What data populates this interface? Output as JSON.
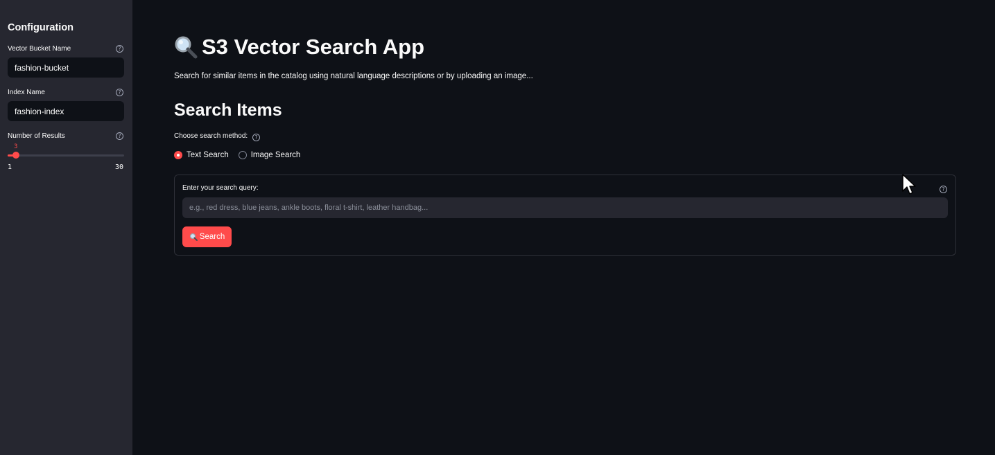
{
  "sidebar": {
    "title": "Configuration",
    "bucket_label": "Vector Bucket Name",
    "bucket_value": "fashion-bucket",
    "index_label": "Index Name",
    "index_value": "fashion-index",
    "results_label": "Number of Results",
    "results_value": "3",
    "results_min": "1",
    "results_max": "30",
    "help_glyph": "?"
  },
  "main": {
    "title": "S3 Vector Search App",
    "subtitle": "Search for similar items in the catalog using natural language descriptions or by uploading an image...",
    "section_title": "Search Items",
    "method_label": "Choose search method:",
    "methods": [
      "Text Search",
      "Image Search"
    ],
    "selected_method": "Text Search",
    "query_label": "Enter your search query:",
    "query_value": "",
    "query_placeholder": "e.g., red dress, blue jeans, ankle boots, floral t-shirt, leather handbag...",
    "search_button": "Search"
  },
  "colors": {
    "accent": "#ff4b4b",
    "background": "#0e1117",
    "sidebar_bg": "#262730"
  },
  "icons": [
    "magnifier-icon",
    "help-icon",
    "mouse-cursor-icon"
  ]
}
